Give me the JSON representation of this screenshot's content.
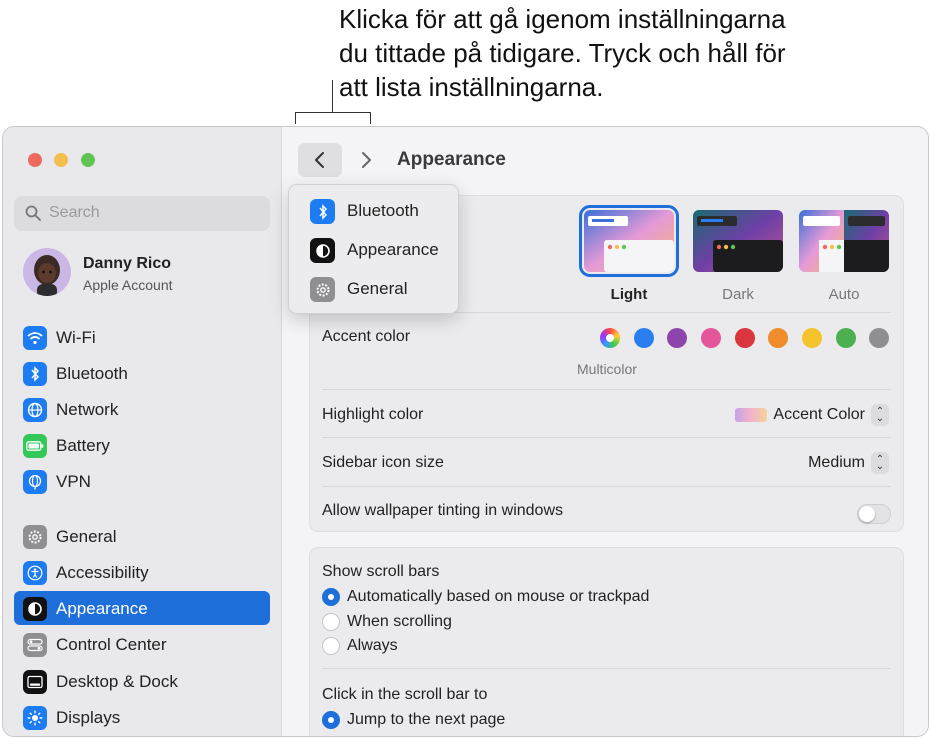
{
  "callout": {
    "line1": "Klicka för att gå igenom inställningarna",
    "line2": "du tittade på tidigare. Tryck och håll för",
    "line3": "att lista inställningarna."
  },
  "search": {
    "placeholder": "Search",
    "icon": "magnifyingglass"
  },
  "account": {
    "name": "Danny Rico",
    "subtitle": "Apple Account"
  },
  "sidebar": {
    "items": [
      {
        "label": "Wi-Fi",
        "icon": "wifi-icon",
        "color": "#1e7cf2"
      },
      {
        "label": "Bluetooth",
        "icon": "bluetooth-icon",
        "color": "#1e7cf2"
      },
      {
        "label": "Network",
        "icon": "globe-icon",
        "color": "#1e7cf2"
      },
      {
        "label": "Battery",
        "icon": "battery-icon",
        "color": "#34c759"
      },
      {
        "label": "VPN",
        "icon": "vpn-globe-icon",
        "color": "#1e7cf2"
      },
      {
        "label": "General",
        "icon": "gear-icon",
        "color": "#8e8e93"
      },
      {
        "label": "Accessibility",
        "icon": "accessibility-icon",
        "color": "#1e7cf2"
      },
      {
        "label": "Appearance",
        "icon": "appearance-icon",
        "color": "#111111",
        "selected": true
      },
      {
        "label": "Control Center",
        "icon": "control-center-icon",
        "color": "#8e8e93"
      },
      {
        "label": "Desktop & Dock",
        "icon": "dock-icon",
        "color": "#111111"
      },
      {
        "label": "Displays",
        "icon": "sun-icon",
        "color": "#1e7cf2"
      }
    ]
  },
  "toolbar": {
    "title": "Appearance"
  },
  "history": {
    "items": [
      {
        "label": "Bluetooth",
        "icon": "bluetooth-icon"
      },
      {
        "label": "Appearance",
        "icon": "appearance-icon"
      },
      {
        "label": "General",
        "icon": "gear-icon"
      }
    ]
  },
  "appearance": {
    "themes": [
      {
        "label": "Light",
        "selected": true
      },
      {
        "label": "Dark",
        "selected": false
      },
      {
        "label": "Auto",
        "selected": false
      }
    ],
    "accent_label": "Accent color",
    "accent_colors": [
      "multicolor",
      "#2a7ef0",
      "#8e44ad",
      "#e5559a",
      "#d9363e",
      "#f08c2b",
      "#f5c42c",
      "#4caf50",
      "#8e8e93"
    ],
    "accent_selected_label": "Multicolor",
    "highlight_label": "Highlight color",
    "highlight_value": "Accent Color",
    "sidebar_icon_label": "Sidebar icon size",
    "sidebar_icon_value": "Medium",
    "tinting_label": "Allow wallpaper tinting in windows",
    "tinting_on": false
  },
  "scroll": {
    "show_label": "Show scroll bars",
    "options": [
      {
        "label": "Automatically based on mouse or trackpad",
        "checked": true
      },
      {
        "label": "When scrolling",
        "checked": false
      },
      {
        "label": "Always",
        "checked": false
      }
    ],
    "click_label": "Click in the scroll bar to",
    "click_options": [
      {
        "label": "Jump to the next page",
        "checked": true
      }
    ]
  }
}
